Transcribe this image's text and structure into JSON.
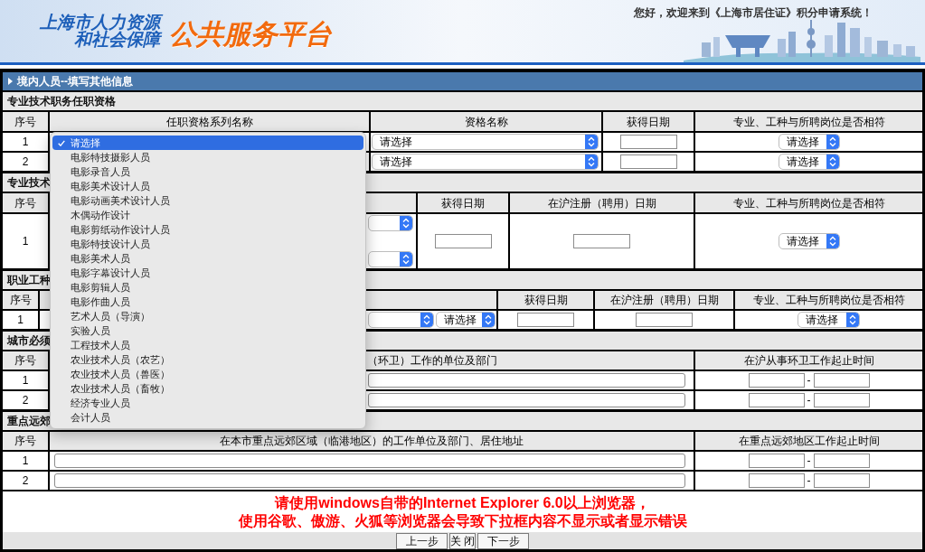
{
  "header": {
    "logo_lines": [
      "上海市人力资源",
      "和社会保障"
    ],
    "platform_name": "公共服务平台",
    "greeting": "您好，欢迎来到《上海市居住证》积分申请系统！"
  },
  "panel": {
    "title": "境内人员--填写其他信息"
  },
  "sections": [
    {
      "title": "专业技术职务任职资格",
      "columns": [
        {
          "label": "序号"
        },
        {
          "label": "任职资格系列名称"
        },
        {
          "label": "资格名称"
        },
        {
          "label": "获得日期"
        },
        {
          "label": "专业、工种与所聘岗位是否相符"
        }
      ],
      "rows": [
        {
          "cells": [
            {
              "text": "1"
            },
            {},
            {
              "fields": [
                {
                  "kind": "select",
                  "value": "请选择"
                }
              ]
            },
            {
              "fields": [
                {
                  "kind": "date"
                }
              ]
            },
            {
              "fields": [
                {
                  "kind": "select",
                  "value": "请选择"
                }
              ]
            }
          ]
        },
        {
          "cells": [
            {
              "text": "2"
            },
            {},
            {
              "fields": [
                {
                  "kind": "select",
                  "value": "请选择"
                }
              ]
            },
            {
              "fields": [
                {
                  "kind": "date"
                }
              ]
            },
            {
              "fields": [
                {
                  "kind": "select",
                  "value": "请选择"
                }
              ]
            }
          ]
        }
      ]
    },
    {
      "title": "专业技术",
      "columns": [
        {
          "label": "序号"
        },
        {},
        {
          "label": "获得日期"
        },
        {
          "label": "在沪注册（聘用）日期"
        },
        {
          "label": "专业、工种与所聘岗位是否相符"
        }
      ],
      "rows": [
        {
          "cells": [
            {
              "text": "1"
            },
            {
              "fields": [
                {
                  "kind": "select"
                },
                {
                  "kind": "select"
                }
              ]
            },
            {
              "fields": [
                {
                  "kind": "date"
                }
              ]
            },
            {
              "fields": [
                {
                  "kind": "date"
                }
              ]
            },
            {
              "fields": [
                {
                  "kind": "select",
                  "value": "请选择"
                }
              ]
            }
          ]
        }
      ]
    },
    {
      "title": "职业工种",
      "columns": [
        {
          "label": "序号"
        },
        {},
        {
          "label": "获得日期"
        },
        {
          "label": "在沪注册（聘用）日期"
        },
        {
          "label": "专业、工种与所聘岗位是否相符"
        }
      ],
      "rows": [
        {
          "cells": [
            {
              "text": "1"
            },
            {
              "fields": [
                {
                  "kind": "select"
                },
                {
                  "kind": "select",
                  "value": "请选择"
                }
              ]
            },
            {
              "fields": [
                {
                  "kind": "date"
                }
              ]
            },
            {
              "fields": [
                {
                  "kind": "date"
                }
              ]
            },
            {
              "fields": [
                {
                  "kind": "select",
                  "value": "请选择"
                }
              ]
            }
          ]
        }
      ]
    },
    {
      "title": "城市必须",
      "columns": [
        {
          "label": "序号"
        },
        {
          "label": "（环卫）工作的单位及部门"
        },
        {
          "label": "在沪从事环卫工作起止时间"
        }
      ],
      "rows": [
        {
          "cells": [
            {
              "text": "1"
            },
            {
              "fields": [
                {
                  "kind": "text_input"
                }
              ]
            },
            {
              "fields": [
                {
                  "kind": "date"
                },
                {
                  "kind": "separator",
                  "text": "-"
                },
                {
                  "kind": "date"
                }
              ]
            }
          ]
        },
        {
          "cells": [
            {
              "text": "2"
            },
            {
              "fields": [
                {
                  "kind": "text_input"
                }
              ]
            },
            {
              "fields": [
                {
                  "kind": "date"
                },
                {
                  "kind": "separator",
                  "text": "-"
                },
                {
                  "kind": "date"
                }
              ]
            }
          ]
        }
      ]
    },
    {
      "title": "重点远郊",
      "columns": [
        {
          "label": "序号"
        },
        {
          "label": "在本市重点远郊区域（临港地区）的工作单位及部门、居住地址"
        },
        {
          "label": "在重点远郊地区工作起止时间"
        }
      ],
      "rows": [
        {
          "cells": [
            {
              "text": "1"
            },
            {
              "fields": [
                {
                  "kind": "text_input"
                }
              ]
            },
            {
              "fields": [
                {
                  "kind": "date"
                },
                {
                  "kind": "separator",
                  "text": "-"
                },
                {
                  "kind": "date"
                }
              ]
            }
          ]
        },
        {
          "cells": [
            {
              "text": "2"
            },
            {
              "fields": [
                {
                  "kind": "text_input"
                }
              ]
            },
            {
              "fields": [
                {
                  "kind": "date"
                },
                {
                  "kind": "separator",
                  "text": "-"
                },
                {
                  "kind": "date"
                }
              ]
            }
          ]
        }
      ]
    }
  ],
  "dropdown": {
    "options": [
      {
        "label": "请选择",
        "selected": true
      },
      {
        "label": "电影特技摄影人员",
        "selected": false
      },
      {
        "label": "电影录音人员",
        "selected": false
      },
      {
        "label": "电影美术设计人员",
        "selected": false
      },
      {
        "label": "电影动画美术设计人员",
        "selected": false
      },
      {
        "label": "木偶动作设计",
        "selected": false
      },
      {
        "label": "电影剪纸动作设计人员",
        "selected": false
      },
      {
        "label": "电影特技设计人员",
        "selected": false
      },
      {
        "label": "电影美术人员",
        "selected": false
      },
      {
        "label": "电影字幕设计人员",
        "selected": false
      },
      {
        "label": "电影剪辑人员",
        "selected": false
      },
      {
        "label": "电影作曲人员",
        "selected": false
      },
      {
        "label": "艺术人员（导演）",
        "selected": false
      },
      {
        "label": "实验人员",
        "selected": false
      },
      {
        "label": "工程技术人员",
        "selected": false
      },
      {
        "label": "农业技术人员（农艺）",
        "selected": false
      },
      {
        "label": "农业技术人员（兽医）",
        "selected": false
      },
      {
        "label": "农业技术人员（畜牧）",
        "selected": false
      },
      {
        "label": "经济专业人员",
        "selected": false
      },
      {
        "label": "会计人员",
        "selected": false
      }
    ]
  },
  "notice_lines": [
    "请使用windows自带的Internet Explorer 6.0以上浏览器，",
    "使用谷歌、傲游、火狐等浏览器会导致下拉框内容不显示或者显示错误"
  ],
  "buttons": [
    {
      "label": "上一步"
    },
    {
      "label": "关 闭"
    },
    {
      "label": "下一步"
    }
  ]
}
